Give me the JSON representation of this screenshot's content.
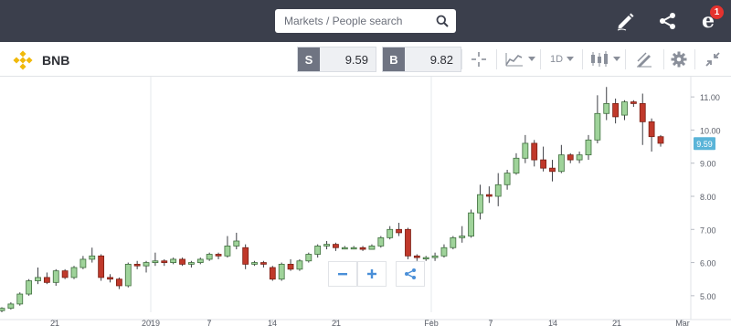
{
  "search": {
    "placeholder": "Markets / People search"
  },
  "topbar": {
    "notification_count": "1",
    "icons": [
      "search-icon",
      "pencil-icon",
      "share-icon",
      "etoro-e-icon"
    ]
  },
  "instrument": {
    "name": "BNB",
    "logo": "binance-logo-icon"
  },
  "trade": {
    "sell_tag": "S",
    "sell_price": "9.59",
    "buy_tag": "B",
    "buy_price": "9.82"
  },
  "toolbar": {
    "timeframe": "1D",
    "icons": [
      "crosshair-icon",
      "indicators-icon",
      "candlestick-icon",
      "draw-icon",
      "gear-icon",
      "collapse-icon"
    ]
  },
  "colors": {
    "up": "#9fd39a",
    "up_border": "#3f6e3d",
    "down": "#c0392b",
    "down_border": "#7a1f14",
    "current_price_bg": "#5ab4d8",
    "accent": "#4a8fd8"
  },
  "chart_data": {
    "type": "candlestick",
    "y_ticks": [
      "11.00",
      "10.00",
      "9.00",
      "8.00",
      "7.00",
      "6.00",
      "5.00"
    ],
    "y_min": 4.5,
    "y_max": 11.5,
    "x_ticks": [
      "21",
      "2019",
      "7",
      "14",
      "21",
      "Feb",
      "7",
      "14",
      "21",
      "Mar"
    ],
    "current_price": "9.59",
    "candles": [
      [
        4.55,
        4.62,
        4.5,
        4.65
      ],
      [
        4.62,
        4.75,
        4.58,
        4.8
      ],
      [
        4.75,
        5.05,
        4.7,
        5.1
      ],
      [
        5.05,
        5.45,
        5.0,
        5.5
      ],
      [
        5.45,
        5.55,
        5.35,
        5.85
      ],
      [
        5.55,
        5.4,
        5.35,
        5.7
      ],
      [
        5.4,
        5.75,
        5.3,
        5.8
      ],
      [
        5.75,
        5.55,
        5.5,
        5.8
      ],
      [
        5.55,
        5.85,
        5.5,
        5.9
      ],
      [
        5.85,
        6.1,
        5.8,
        6.2
      ],
      [
        6.1,
        6.2,
        6.0,
        6.45
      ],
      [
        6.2,
        5.55,
        5.45,
        6.25
      ],
      [
        5.55,
        5.5,
        5.4,
        5.65
      ],
      [
        5.5,
        5.3,
        5.2,
        5.55
      ],
      [
        5.3,
        5.95,
        5.25,
        6.0
      ],
      [
        5.95,
        5.9,
        5.8,
        6.05
      ],
      [
        5.9,
        6.0,
        5.7,
        6.05
      ],
      [
        6.0,
        6.05,
        5.9,
        6.3
      ],
      [
        6.05,
        6.0,
        5.9,
        6.1
      ],
      [
        6.0,
        6.1,
        5.95,
        6.15
      ],
      [
        6.1,
        5.95,
        5.9,
        6.15
      ],
      [
        5.95,
        6.0,
        5.85,
        6.05
      ],
      [
        6.0,
        6.1,
        5.95,
        6.15
      ],
      [
        6.1,
        6.25,
        6.05,
        6.3
      ],
      [
        6.25,
        6.2,
        6.1,
        6.3
      ],
      [
        6.2,
        6.5,
        6.15,
        6.8
      ],
      [
        6.5,
        6.65,
        6.4,
        6.9
      ],
      [
        6.45,
        5.95,
        5.8,
        6.55
      ],
      [
        5.95,
        6.0,
        5.9,
        6.05
      ],
      [
        6.0,
        5.95,
        5.85,
        6.05
      ],
      [
        5.85,
        5.5,
        5.45,
        5.9
      ],
      [
        5.5,
        5.95,
        5.45,
        6.0
      ],
      [
        5.95,
        5.8,
        5.75,
        6.1
      ],
      [
        5.8,
        6.05,
        5.75,
        6.1
      ],
      [
        6.05,
        6.25,
        6.0,
        6.3
      ],
      [
        6.25,
        6.5,
        6.15,
        6.55
      ],
      [
        6.5,
        6.55,
        6.4,
        6.65
      ],
      [
        6.55,
        6.45,
        6.35,
        6.6
      ],
      [
        6.45,
        6.45,
        6.4,
        6.5
      ],
      [
        6.45,
        6.45,
        6.4,
        6.5
      ],
      [
        6.45,
        6.4,
        6.35,
        6.5
      ],
      [
        6.4,
        6.5,
        6.4,
        6.55
      ],
      [
        6.5,
        6.75,
        6.45,
        6.8
      ],
      [
        6.75,
        7.0,
        6.7,
        7.1
      ],
      [
        7.0,
        6.9,
        6.8,
        7.2
      ],
      [
        7.0,
        6.2,
        6.1,
        7.05
      ],
      [
        6.2,
        6.15,
        6.05,
        6.25
      ],
      [
        6.15,
        6.15,
        6.05,
        6.2
      ],
      [
        6.15,
        6.2,
        6.05,
        6.3
      ],
      [
        6.2,
        6.45,
        6.15,
        6.55
      ],
      [
        6.45,
        6.75,
        6.4,
        6.8
      ],
      [
        6.75,
        6.8,
        6.6,
        7.1
      ],
      [
        6.8,
        7.5,
        6.75,
        7.6
      ],
      [
        7.5,
        8.05,
        7.3,
        8.35
      ],
      [
        8.05,
        8.0,
        7.8,
        8.3
      ],
      [
        8.0,
        8.35,
        7.7,
        8.7
      ],
      [
        8.35,
        8.7,
        8.2,
        8.8
      ],
      [
        8.7,
        9.15,
        8.65,
        9.3
      ],
      [
        9.15,
        9.6,
        9.0,
        9.85
      ],
      [
        9.6,
        9.1,
        8.9,
        9.7
      ],
      [
        9.1,
        8.85,
        8.75,
        9.5
      ],
      [
        8.85,
        8.75,
        8.45,
        9.1
      ],
      [
        8.75,
        9.25,
        8.7,
        9.55
      ],
      [
        9.25,
        9.1,
        9.0,
        9.3
      ],
      [
        9.1,
        9.25,
        9.0,
        9.35
      ],
      [
        9.25,
        9.7,
        9.1,
        9.85
      ],
      [
        9.7,
        10.5,
        9.6,
        11.05
      ],
      [
        10.5,
        10.8,
        10.3,
        11.3
      ],
      [
        10.8,
        10.4,
        10.2,
        10.95
      ],
      [
        10.45,
        10.85,
        10.3,
        10.9
      ],
      [
        10.85,
        10.8,
        10.7,
        10.9
      ],
      [
        10.8,
        10.25,
        9.55,
        11.1
      ],
      [
        10.25,
        9.8,
        9.35,
        10.35
      ],
      [
        9.8,
        9.6,
        9.5,
        9.85
      ]
    ]
  }
}
